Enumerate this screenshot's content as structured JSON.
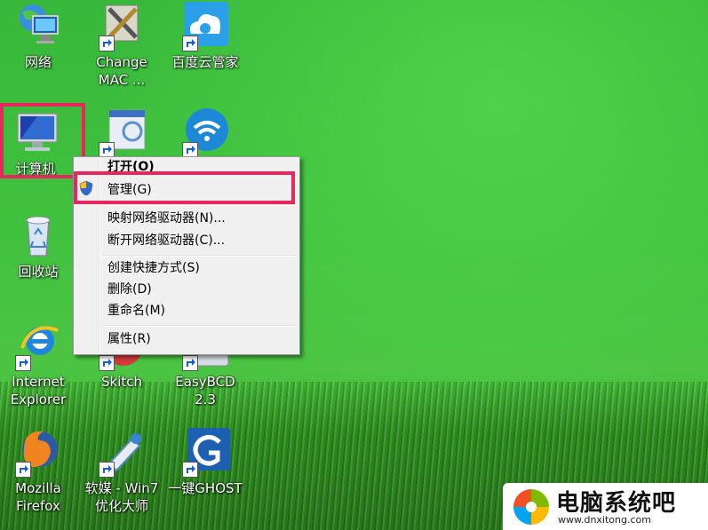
{
  "desktop": {
    "icons": [
      {
        "label": "网络"
      },
      {
        "label": "Change MAC ..."
      },
      {
        "label": "百度云管家"
      },
      {
        "label": "计算机"
      },
      {
        "label": "回收站"
      },
      {
        "label": "Internet Explorer"
      },
      {
        "label": "Skitch"
      },
      {
        "label": "EasyBCD 2.3"
      },
      {
        "label": "Mozilla Firefox"
      },
      {
        "label": "软媒 - Win7 优化大师"
      },
      {
        "label": "一键GHOST"
      }
    ]
  },
  "context_menu": {
    "open": "打开(O)",
    "manage": "管理(G)",
    "map_drive": "映射网络驱动器(N)...",
    "disconnect_drive": "断开网络驱动器(C)...",
    "create_shortcut": "创建快捷方式(S)",
    "delete": "删除(D)",
    "rename": "重命名(M)",
    "properties": "属性(R)"
  },
  "watermark": {
    "title": "电脑系统吧",
    "url": "www.dnxitong.com"
  },
  "colors": {
    "highlight": "#e8275e",
    "desktop": "#41c23f"
  }
}
